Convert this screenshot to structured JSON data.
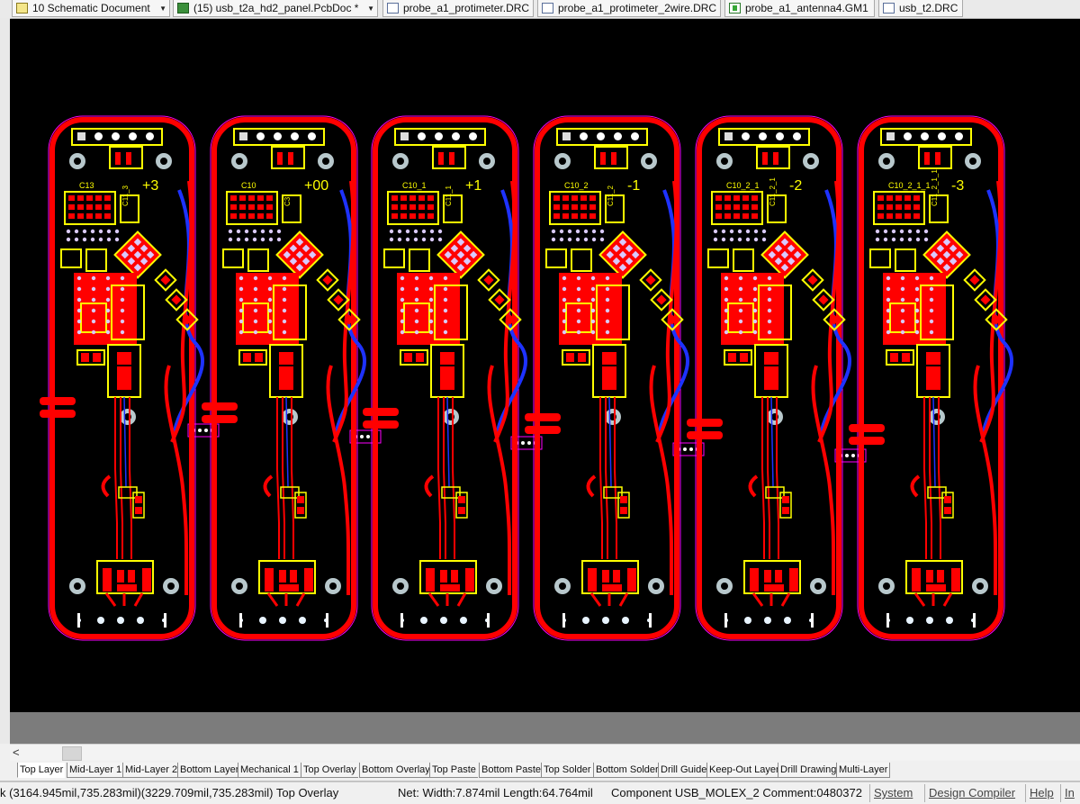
{
  "document_tabs": [
    {
      "label": "10 Schematic Document",
      "icon": "schematic-icon",
      "has_dropdown": true
    },
    {
      "label": "(15) usb_t2a_hd2_panel.PcbDoc *",
      "icon": "pcb-icon",
      "has_dropdown": true
    },
    {
      "label": "probe_a1_protimeter.DRC",
      "icon": "drc-doc-icon",
      "has_dropdown": false
    },
    {
      "label": "probe_a1_protimeter_2wire.DRC",
      "icon": "drc-doc-icon",
      "has_dropdown": false
    },
    {
      "label": "probe_a1_antenna4.GM1",
      "icon": "gerber-doc-icon",
      "has_dropdown": false
    },
    {
      "label": "usb_t2.DRC",
      "icon": "drc-doc-icon",
      "has_dropdown": false
    }
  ],
  "boards": [
    {
      "label": "+3",
      "ref": "C13",
      "ref2": "C11_3"
    },
    {
      "label": "+00",
      "ref": "C10",
      "ref2": "C3"
    },
    {
      "label": "+1",
      "ref": "C10_1",
      "ref2": "C11_1"
    },
    {
      "label": "-1",
      "ref": "C10_2",
      "ref2": "C11_2"
    },
    {
      "label": "-2",
      "ref": "C10_2_1",
      "ref2": "C11_2_1"
    },
    {
      "label": "-3",
      "ref": "C10_2_1_1",
      "ref2": "C11_2_1_1"
    }
  ],
  "layer_tabs": [
    {
      "label": "Top Layer",
      "active": true
    },
    {
      "label": "Mid-Layer 1",
      "active": false
    },
    {
      "label": "Mid-Layer 2",
      "active": false
    },
    {
      "label": "Bottom Layer",
      "active": false
    },
    {
      "label": "Mechanical 1",
      "active": false
    },
    {
      "label": "Top Overlay",
      "active": false
    },
    {
      "label": "Bottom Overlay",
      "active": false
    },
    {
      "label": "Top Paste",
      "active": false
    },
    {
      "label": "Bottom Paste",
      "active": false
    },
    {
      "label": "Top Solder",
      "active": false
    },
    {
      "label": "Bottom Solder",
      "active": false
    },
    {
      "label": "Drill Guide",
      "active": false
    },
    {
      "label": "Keep-Out Layer",
      "active": false
    },
    {
      "label": "Drill Drawing",
      "active": false
    },
    {
      "label": "Multi-Layer",
      "active": false
    }
  ],
  "status": {
    "coords": "k (3164.945mil,735.283mil)(3229.709mil,735.283mil)  Top Overlay",
    "net_info": "Net: Width:7.874mil Length:64.764mil",
    "component_info": "Component USB_MOLEX_2 Comment:0480372",
    "panels": [
      "System",
      "Design Compiler",
      "Help",
      "In"
    ]
  },
  "colors": {
    "top_layer": "#ff0000",
    "bottom_layer": "#1e32ff",
    "overlay": "#ffff00",
    "keepout": "#ff00ff",
    "background": "#000000"
  }
}
